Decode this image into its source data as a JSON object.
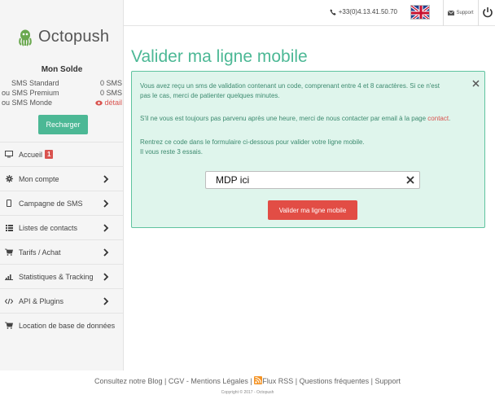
{
  "header": {
    "phone": "+33(0)4.13.41.50.70",
    "support_label": "Support"
  },
  "brand": {
    "name": "Octopush"
  },
  "balance": {
    "title": "Mon Solde",
    "rows": [
      {
        "label": "SMS Standard",
        "value": "0 SMS"
      },
      {
        "label": "ou SMS Premium",
        "value": "0 SMS"
      },
      {
        "label": "ou SMS Monde",
        "value": "détail"
      }
    ],
    "recharge_label": "Recharger"
  },
  "nav": {
    "items": [
      {
        "label": "Accueil",
        "badge": "1"
      },
      {
        "label": "Mon compte"
      },
      {
        "label": "Campagne de SMS"
      },
      {
        "label": "Listes de contacts"
      },
      {
        "label": "Tarifs / Achat"
      },
      {
        "label": "Statistiques & Tracking"
      },
      {
        "label": "API & Plugins"
      },
      {
        "label": "Location de base de données"
      }
    ]
  },
  "main": {
    "title": "Valider ma ligne mobile",
    "alert": {
      "line1": "Vous avez reçu un sms de validation contenant un code, comprenant entre 4 et 8 caractères. Si ce n'est",
      "line2": "pas le cas, merci de patienter quelques minutes.",
      "line3_prefix": "S'il ne vous est toujours pas parvenu après une heure, merci de nous contacter par email à la page ",
      "line3_link": "contact",
      "line3_suffix": ".",
      "line4": "Rentrez ce code dans le formulaire ci-dessous pour valider votre ligne mobile.",
      "line5": "Il vous reste 3 essais."
    },
    "code_input_value": "MDP ici",
    "submit_label": "Valider ma ligne mobile"
  },
  "footer": {
    "links": [
      "Consultez notre Blog",
      "CGV - Mentions Légales",
      "Flux RSS",
      "Questions fréquentes",
      "Support"
    ],
    "separator": " | ",
    "copyright": "Copyright © 2017 - Octopush"
  },
  "colors": {
    "accent": "#4cb895",
    "danger": "#d9534f",
    "alert_bg": "#dff5ec",
    "alert_border": "#5fc39f"
  }
}
